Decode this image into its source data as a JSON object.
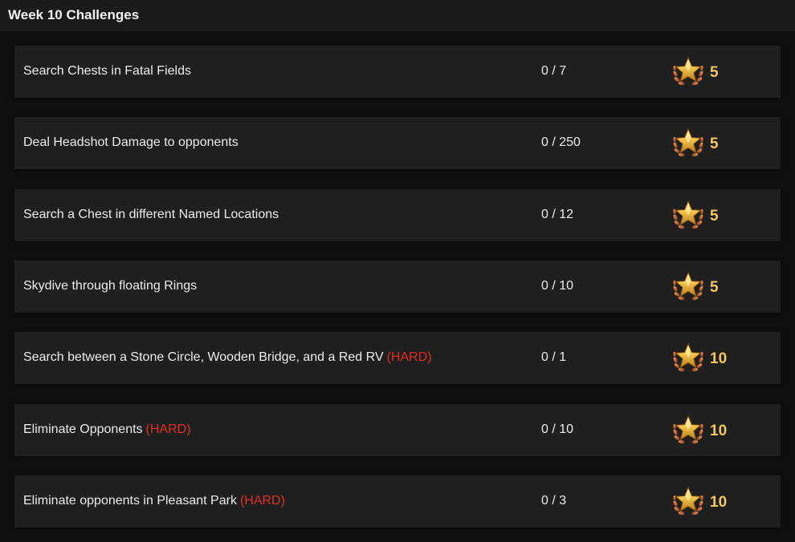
{
  "header": {
    "title": "Week 10 Challenges"
  },
  "challenges": [
    {
      "name": "Search Chests in Fatal Fields",
      "hard": "",
      "progress": "0 / 7",
      "reward": "5"
    },
    {
      "name": "Deal Headshot Damage to opponents",
      "hard": "",
      "progress": "0 / 250",
      "reward": "5"
    },
    {
      "name": "Search a Chest in different Named Locations",
      "hard": "",
      "progress": "0 / 12",
      "reward": "5"
    },
    {
      "name": "Skydive through floating Rings",
      "hard": "",
      "progress": "0 / 10",
      "reward": "5"
    },
    {
      "name": "Search between a Stone Circle, Wooden Bridge, and a Red RV",
      "hard": "(HARD)",
      "progress": "0 / 1",
      "reward": "10"
    },
    {
      "name": "Eliminate Opponents",
      "hard": "(HARD)",
      "progress": "0 / 10",
      "reward": "10"
    },
    {
      "name": "Eliminate opponents in Pleasant Park",
      "hard": "(HARD)",
      "progress": "0 / 3",
      "reward": "10"
    }
  ],
  "icons": {
    "reward": "battle-star-icon"
  },
  "colors": {
    "background": "#0f0f0f",
    "header": "#1b1b1b",
    "row": "#1f1f1f",
    "hard_tag": "#e02f25",
    "reward_value": "#f0c860",
    "star_gold": "#f3c44c",
    "laurel_bronze": "#b86a3c"
  }
}
